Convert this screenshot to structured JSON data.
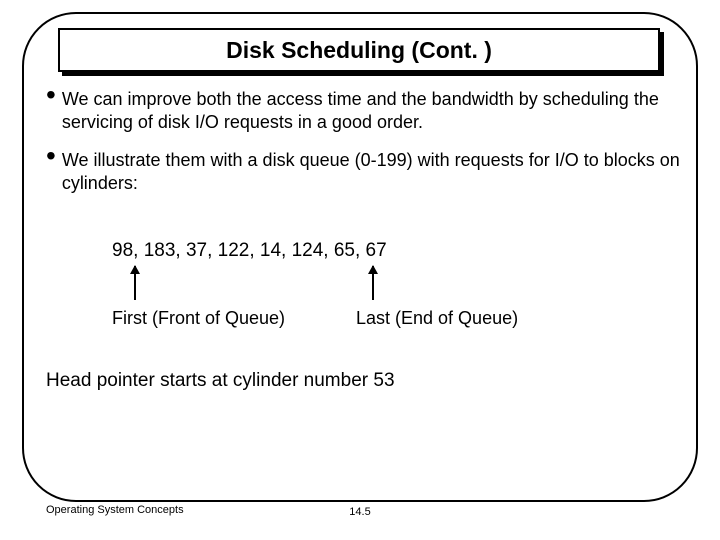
{
  "title": "Disk Scheduling (Cont. )",
  "bullets": [
    "We can improve both the access time and the bandwidth by scheduling the servicing of disk I/O requests in a good order.",
    "We illustrate them with a disk queue (0-199) with requests for I/O to blocks on cylinders:"
  ],
  "queue_values": "98, 183, 37, 122, 14, 124, 65, 67",
  "labels": {
    "first": "First (Front of Queue)",
    "last": "Last (End of Queue)"
  },
  "head_pointer": "Head pointer starts at cylinder number 53",
  "footer": {
    "left": "Operating System Concepts",
    "center": "14.5"
  }
}
